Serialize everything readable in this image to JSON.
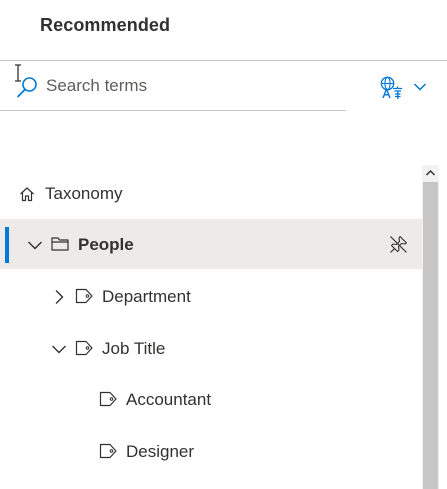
{
  "header": {
    "title": "Recommended"
  },
  "search": {
    "placeholder": "Search terms"
  },
  "tree": {
    "root": {
      "label": "Taxonomy"
    },
    "items": [
      {
        "label": "People",
        "selected": true,
        "expanded": true
      },
      {
        "label": "Department",
        "expanded": false
      },
      {
        "label": "Job Title",
        "expanded": true
      },
      {
        "label": "Accountant"
      },
      {
        "label": "Designer"
      }
    ]
  },
  "colors": {
    "accent": "#0078d4",
    "selected_bg": "#edebe9",
    "text": "#323130",
    "divider": "#c8c6c4",
    "scrollbar_thumb": "#c8c6c4"
  },
  "icons": {
    "search": "search-icon",
    "language": "translate-icon",
    "home": "home-icon",
    "folder": "folder-icon",
    "tag": "tag-icon",
    "pin": "pin-off-icon"
  }
}
